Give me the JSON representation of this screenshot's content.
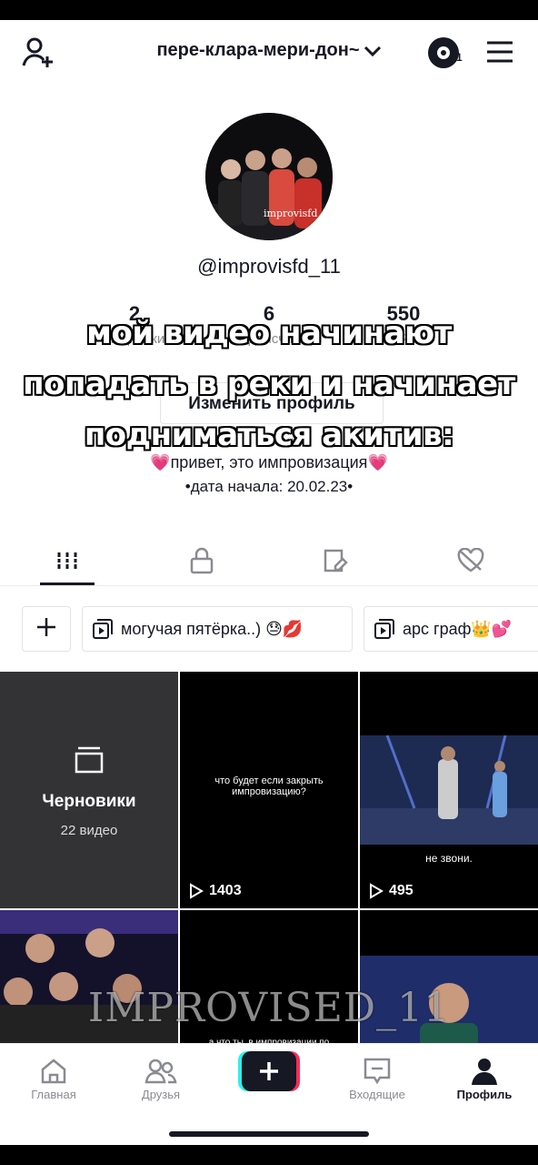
{
  "header": {
    "account_name": "пере-клара-мери-дон~",
    "coin_count": "1"
  },
  "profile": {
    "username": "@improvisfd_11",
    "stats": [
      {
        "number": "2",
        "label": "Подписки"
      },
      {
        "number": "6",
        "label": "Подписчики"
      },
      {
        "number": "550",
        "label": "Лайки"
      }
    ],
    "edit_button": "Изменить профиль",
    "bio_line1": "привет, это импровизация",
    "bio_line2": "•дата начала: 20.02.23•"
  },
  "caption": {
    "line1": "мой видео начинают",
    "line2": "попадать в реки и начинает",
    "line3": "подниматься акитив:"
  },
  "tabs": [
    "videos-grid-icon",
    "lock-icon",
    "tagged-icon",
    "liked-icon"
  ],
  "playlists": [
    {
      "label": "могучая пятёрка..) 😓💋"
    },
    {
      "label": "арс граф👑💕"
    }
  ],
  "grid": {
    "drafts_title": "Черновики",
    "drafts_count": "22 видео",
    "video1_text": "что будет если закрыть импровизацию?",
    "video1_views": "1403",
    "video2_text": "не звони.",
    "video2_views": "495",
    "video4_text": "а что ты, в импровизации по характеру?"
  },
  "watermark": "IMPROVISED_11",
  "nav": {
    "home": "Главная",
    "friends": "Друзья",
    "inbox": "Входящие",
    "profile": "Профиль"
  },
  "colors": {
    "accent_pink": "#ff4fa3",
    "text": "#161823",
    "muted": "#8a8b91"
  }
}
